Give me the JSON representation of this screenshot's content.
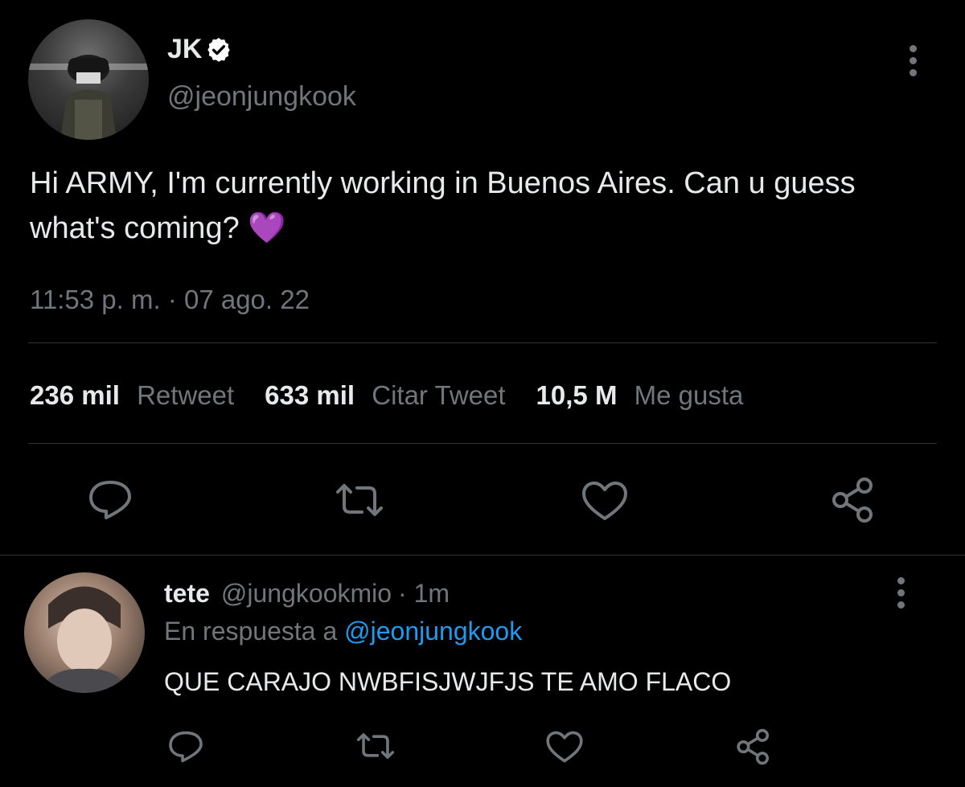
{
  "tweet": {
    "display_name": "JK",
    "handle": "@jeonjungkook",
    "text": "Hi ARMY, I'm currently working in Buenos Aires. Can u guess what's coming?",
    "emoji": "💜",
    "timestamp": "11:53 p. m. · 07 ago. 22",
    "stats": {
      "retweets_count": "236 mil",
      "retweets_label": "Retweet",
      "quotes_count": "633 mil",
      "quotes_label": "Citar Tweet",
      "likes_count": "10,5 M",
      "likes_label": "Me gusta"
    }
  },
  "reply": {
    "display_name": "tete",
    "handle": "@jungkookmio",
    "time": "· 1m",
    "in_reply_prefix": "En respuesta a",
    "in_reply_handle": "@jeonjungkook",
    "text": "QUE CARAJO NWBFISJWJFJS TE AMO FLACO"
  },
  "icons": [
    "reply-icon",
    "retweet-icon",
    "like-icon",
    "share-icon",
    "more-options-icon",
    "verified-badge-icon"
  ],
  "colors": {
    "background": "#000000",
    "text": "#e7e9ea",
    "muted": "#71767b",
    "link": "#1d9bf0",
    "divider": "#2f3336",
    "verified": "#ffffff"
  }
}
